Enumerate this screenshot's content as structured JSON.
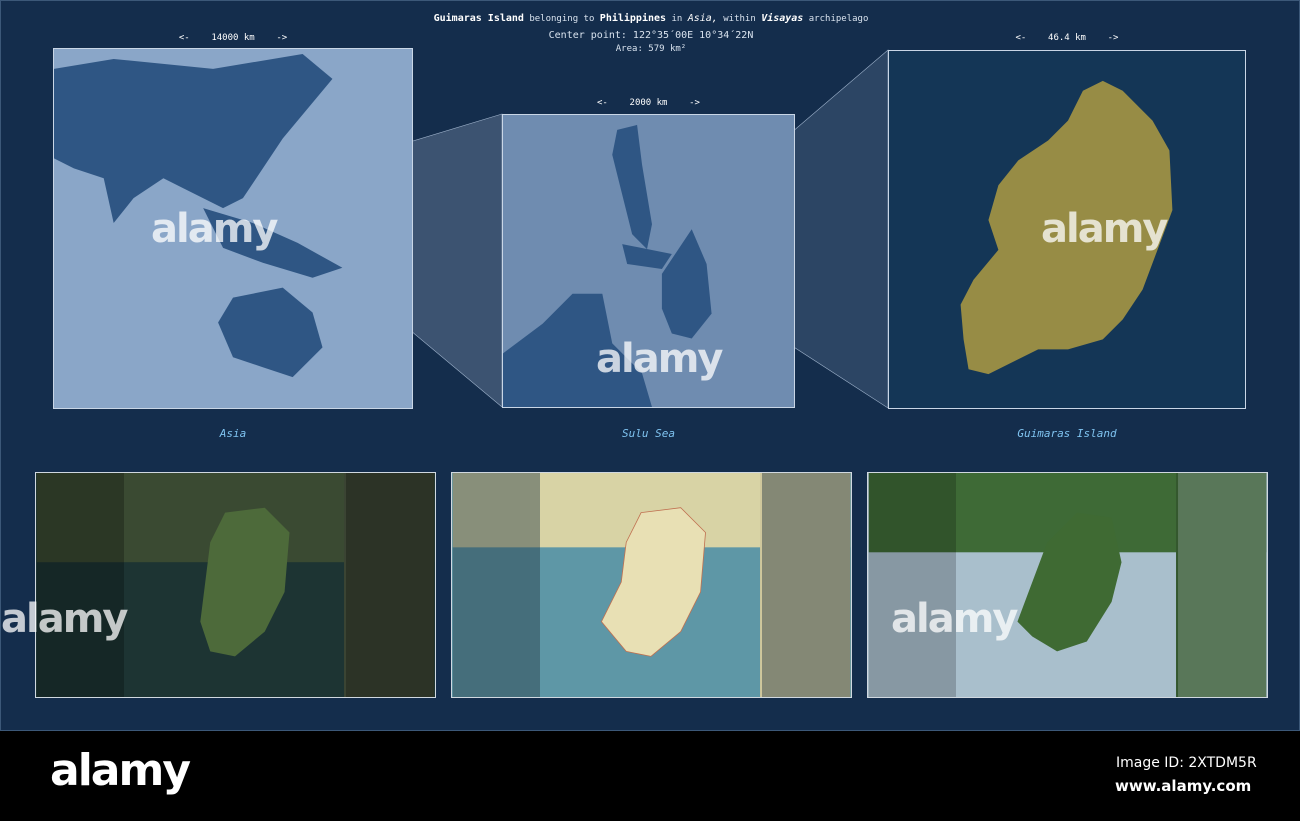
{
  "header": {
    "island": "Guimaras Island",
    "t1": "belonging to",
    "country": "Philippines",
    "t2": "in",
    "continent": "Asia,",
    "t3": "within",
    "archipelago": "Visayas",
    "t4": "archipelago",
    "center": "Center point: 122°35´00E  10°34´22N",
    "area": "Area: 579 km²"
  },
  "panels": [
    {
      "scale": "<-    14000 km    ->",
      "caption": "Asia"
    },
    {
      "scale": "<-    2000 km    ->",
      "caption": "Sulu Sea"
    },
    {
      "scale": "<-    46.4 km    ->",
      "caption": "Guimaras Island"
    }
  ],
  "colors": {
    "frame": "#142d4c",
    "island": "#978c45",
    "caption": "#7fc3f0"
  },
  "watermark": "alamy",
  "footer": {
    "logo": "alamy",
    "image_id": "Image ID: 2XTDM5R",
    "site": "www.alamy.com"
  }
}
